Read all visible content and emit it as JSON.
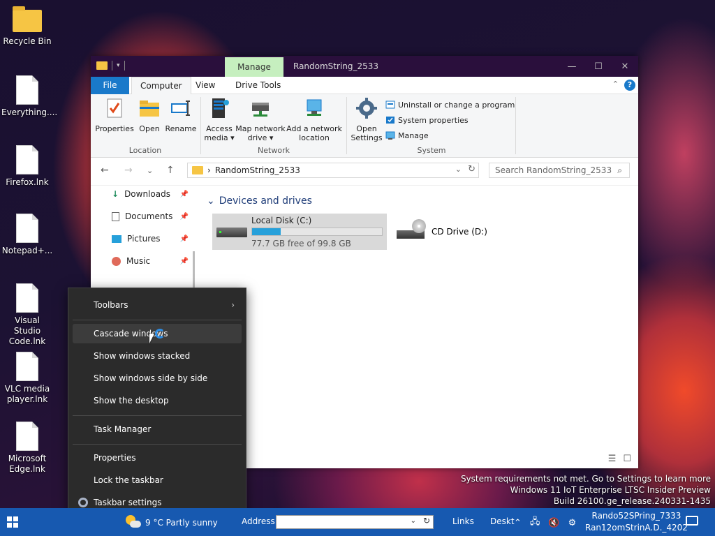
{
  "desktop": {
    "icons": [
      {
        "label": "Recycle Bin"
      },
      {
        "label": "Everything...."
      },
      {
        "label": "Firefox.lnk"
      },
      {
        "label": "Notepad+..."
      },
      {
        "label": "Visual Studio Code.lnk"
      },
      {
        "label": "VLC media player.lnk"
      },
      {
        "label": "Microsoft Edge.lnk"
      }
    ]
  },
  "explorer": {
    "window_title": "RandomString_2533",
    "contextual_tab": "Manage",
    "tabs": {
      "file": "File",
      "computer": "Computer",
      "view": "View",
      "drive_tools": "Drive Tools"
    },
    "ribbon": {
      "location": {
        "label": "Location",
        "properties": "Properties",
        "open": "Open",
        "rename": "Rename"
      },
      "network": {
        "label": "Network",
        "access_media": "Access media ▾",
        "map_drive": "Map network drive ▾",
        "add_location": "Add a network location"
      },
      "system": {
        "label": "System",
        "open_settings": "Open Settings",
        "uninstall": "Uninstall or change a program",
        "system_properties": "System properties",
        "manage": "Manage"
      }
    },
    "address": {
      "path": "RandomString_2533",
      "search_placeholder": "Search RandomString_2533"
    },
    "nav": [
      {
        "label": "Downloads"
      },
      {
        "label": "Documents"
      },
      {
        "label": "Pictures"
      },
      {
        "label": "Music"
      }
    ],
    "section": "Devices and drives",
    "drives": [
      {
        "name": "Local Disk (C:)",
        "free": "77.7 GB free of 99.8 GB",
        "used_fraction": 0.22
      },
      {
        "name": "CD Drive (D:)"
      }
    ]
  },
  "context_menu": {
    "toolbars": "Toolbars",
    "cascade": "Cascade windows",
    "stacked": "Show windows stacked",
    "side_by_side": "Show windows side by side",
    "show_desktop": "Show the desktop",
    "task_manager": "Task Manager",
    "properties": "Properties",
    "lock": "Lock the taskbar",
    "settings": "Taskbar settings"
  },
  "taskbar": {
    "weather": "9 °C  Partly sunny",
    "address_label": "Address",
    "links": "Links",
    "desktop": "Deskt",
    "clock_line1": "Rando52SPring_7333",
    "clock_line2": "Ran12omStrinA.D._4202"
  },
  "watermark": {
    "line1": "System requirements not met. Go to Settings to learn more",
    "line2": "Windows 11 IoT Enterprise LTSC Insider Preview",
    "line3": "Build 26100.ge_release.240331-1435"
  }
}
